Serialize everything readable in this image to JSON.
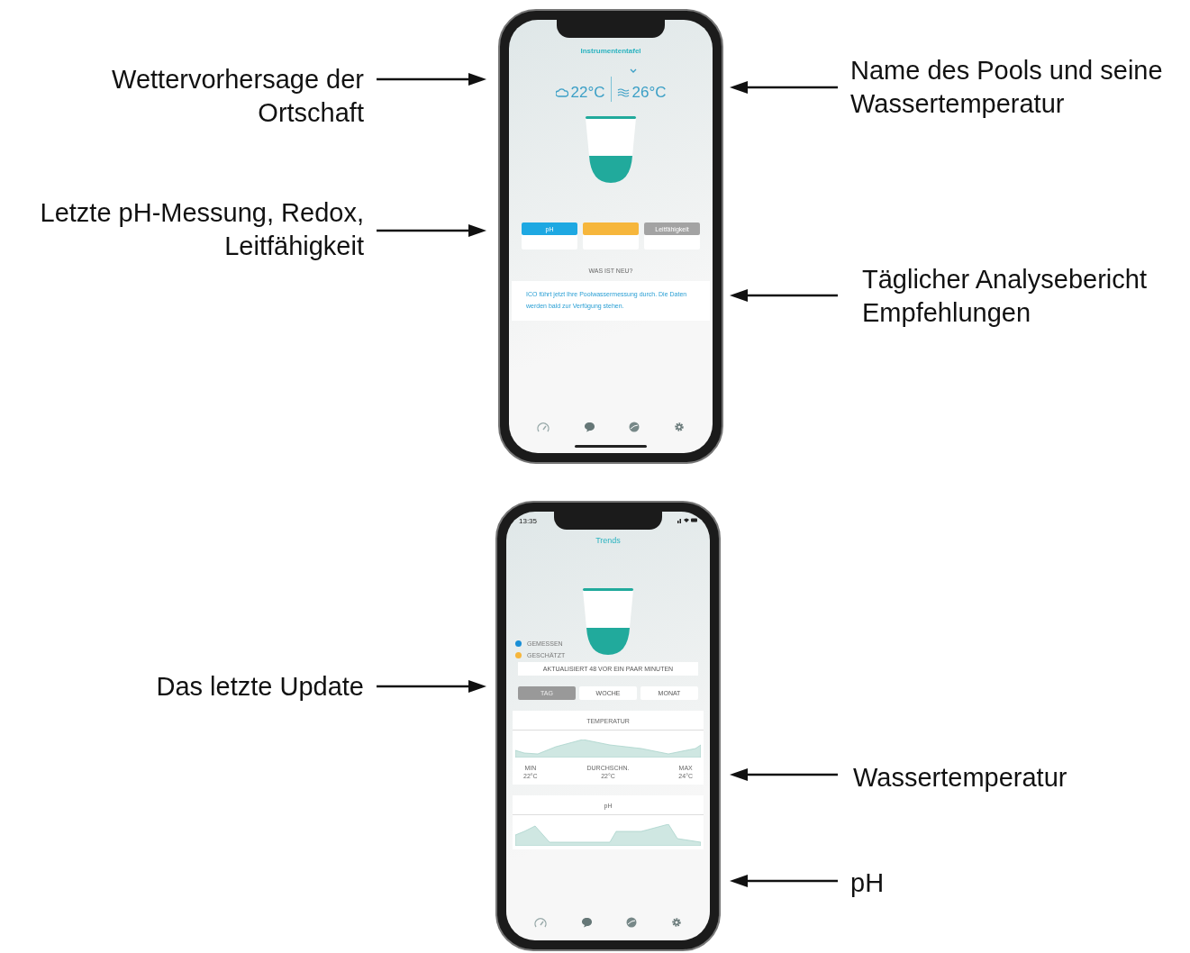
{
  "figures": [
    {
      "screen": {
        "kind": "dashboard",
        "title": "Instrumententafel",
        "weather_temp": "22°C",
        "pool_temp": "26°C",
        "tabs": [
          {
            "label": "pH",
            "color": "#1ea8e2"
          },
          {
            "color": "#f6b63c"
          },
          {
            "label": "Leitfähigkeit",
            "color": "#a3a3a3"
          }
        ],
        "news_heading": "WAS IST NEU?",
        "news_text": "ICO führt jetzt Ihre Poolwassermessung durch. Die Daten werden bald zur Verfügung stehen."
      },
      "callouts": [
        {
          "kind": "left",
          "text": "Wettervorhersage der Ortschaft"
        },
        {
          "kind": "left",
          "text": "Letzte pH-Messung, Redox, Leitfähigkeit"
        },
        {
          "kind": "right",
          "text": "Name des Pools und seine Wassertemperatur"
        },
        {
          "kind": "right",
          "text": "Täglicher Analysebericht Empfehlungen"
        }
      ]
    },
    {
      "screen": {
        "kind": "trends",
        "time": "13:35",
        "title": "Trends",
        "legend": [
          {
            "label": "GEMESSEN",
            "color": "#1a8fd6"
          },
          {
            "label": "GESCHÄTZT",
            "color": "#f6b63c"
          }
        ],
        "update": "AKTUALISIERT 48 VOR EIN PAAR MINUTEN",
        "periods": [
          {
            "label": "TAG",
            "selected": true
          },
          {
            "label": "WOCHE",
            "selected": false
          },
          {
            "label": "MONAT",
            "selected": false
          }
        ],
        "cards": [
          {
            "title": "TEMPERATUR",
            "stats": [
              {
                "label": "MIN",
                "value": "22°C"
              },
              {
                "label": "DURCHSCHN.",
                "value": "22°C"
              },
              {
                "label": "MAX",
                "value": "24°C"
              }
            ]
          },
          {
            "title": "pH"
          }
        ]
      },
      "callouts": [
        {
          "kind": "left",
          "text": "Das letzte Update"
        },
        {
          "kind": "right",
          "text": "Wassertemperatur"
        },
        {
          "kind": "right",
          "text": "pH"
        }
      ]
    }
  ]
}
